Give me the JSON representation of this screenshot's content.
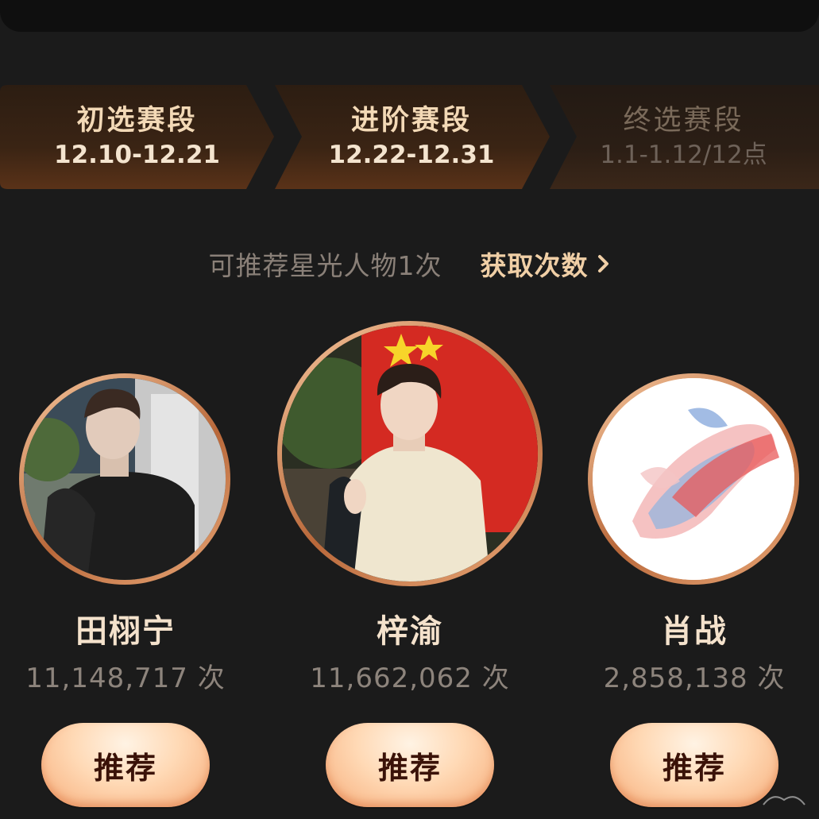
{
  "stages": [
    {
      "title": "初选赛段",
      "dates": "12.10-12.21"
    },
    {
      "title": "进阶赛段",
      "dates": "12.22-12.31"
    },
    {
      "title": "终选赛段",
      "dates": "1.1-1.12/12点"
    }
  ],
  "quota": {
    "text": "可推荐星光人物1次",
    "link_label": "获取次数"
  },
  "candidates": [
    {
      "name": "田栩宁",
      "votes": "11,148,717 次",
      "button_label": "推荐"
    },
    {
      "name": "梓渝",
      "votes": "11,662,062 次",
      "button_label": "推荐"
    },
    {
      "name": "肖战",
      "votes": "2,858,138 次",
      "button_label": "推荐"
    }
  ],
  "colors": {
    "background": "#1b1b1b",
    "accent": "#f0cfa6",
    "button": "#ffd9b5"
  }
}
